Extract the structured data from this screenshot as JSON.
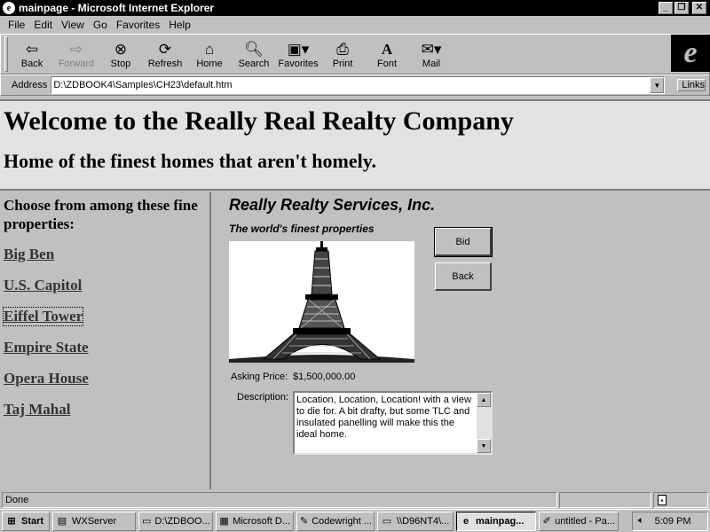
{
  "window": {
    "title": "mainpage - Microsoft Internet Explorer"
  },
  "menu": [
    "File",
    "Edit",
    "View",
    "Go",
    "Favorites",
    "Help"
  ],
  "toolbar": {
    "back": "Back",
    "forward": "Forward",
    "stop": "Stop",
    "refresh": "Refresh",
    "home": "Home",
    "search": "Search",
    "favorites": "Favorites",
    "print": "Print",
    "font": "Font",
    "mail": "Mail"
  },
  "address": {
    "label": "Address",
    "url": "D:\\ZDBOOK4\\Samples\\CH23\\default.htm",
    "links": "Links"
  },
  "banner": {
    "title": "Welcome to the Really Real Realty Company",
    "subtitle": "Home of the finest homes that aren't homely."
  },
  "sidebar": {
    "heading": "Choose from among these fine properties:",
    "properties": [
      "Big Ben",
      "U.S. Capitol",
      "Eiffel Tower",
      "Empire State",
      "Opera House",
      "Taj Mahal"
    ]
  },
  "detail": {
    "company": "Really Realty Services, Inc.",
    "tagline": "The world's finest properties",
    "bid_label": "Bid",
    "back_label": "Back",
    "price_label": "Asking Price:",
    "price_value": "$1,500,000.00",
    "description_label": "Description:",
    "description": "Location, Location, Location! with a view to die for. A bit drafty, but some TLC and insulated panelling will make this the ideal home."
  },
  "status": {
    "text": "Done"
  },
  "taskbar": {
    "start": "Start",
    "tasks": [
      "WXServer",
      "D:\\ZDBOO...",
      "Microsoft D...",
      "Codewright ...",
      "\\\\D96NT4\\...",
      "mainpag...",
      "untitled - Pa..."
    ],
    "clock": "5:09 PM"
  }
}
